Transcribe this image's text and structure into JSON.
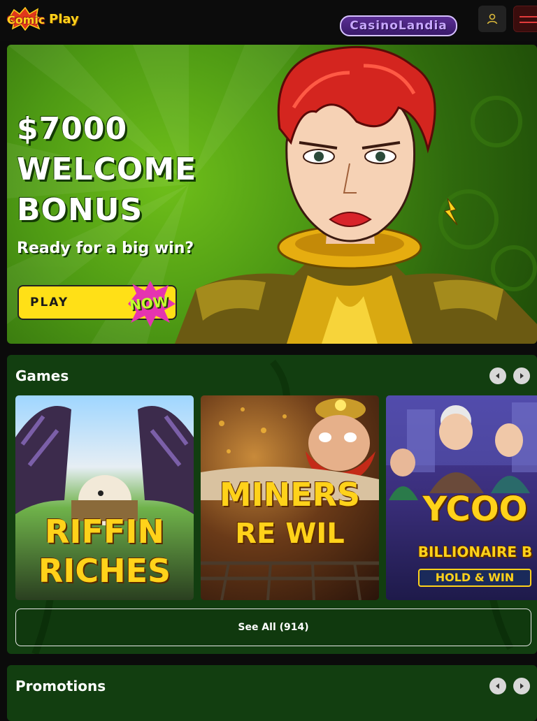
{
  "header": {
    "logo_word1": "Comic",
    "logo_word2": "Play",
    "partner_logo": "CasinoLandia",
    "user_icon": "user-icon",
    "menu_icon": "hamburger-menu-icon"
  },
  "hero": {
    "title_line1": "$7000",
    "title_line2": "WELCOME",
    "title_line3": "BONUS",
    "subtitle": "Ready for a big win?",
    "cta_label": "PLAY",
    "cta_badge": "NOW"
  },
  "games": {
    "title": "Games",
    "prev_icon": "chevron-left-icon",
    "next_icon": "chevron-right-icon",
    "tiles": [
      {
        "line1": "RIFFIN",
        "line2": "RICHES"
      },
      {
        "line1": "MINERS",
        "line2": "RE WIL"
      },
      {
        "line1": "YCOO",
        "line2": "BILLIONAIRE B",
        "badge": "HOLD & WIN"
      }
    ],
    "see_all": "See All (914)"
  },
  "promotions": {
    "title": "Promotions"
  },
  "colors": {
    "accent_yellow": "#ffe017",
    "hero_green": "#4e9a14",
    "section_green": "#123e10",
    "topbar": "#0c0c0c"
  }
}
